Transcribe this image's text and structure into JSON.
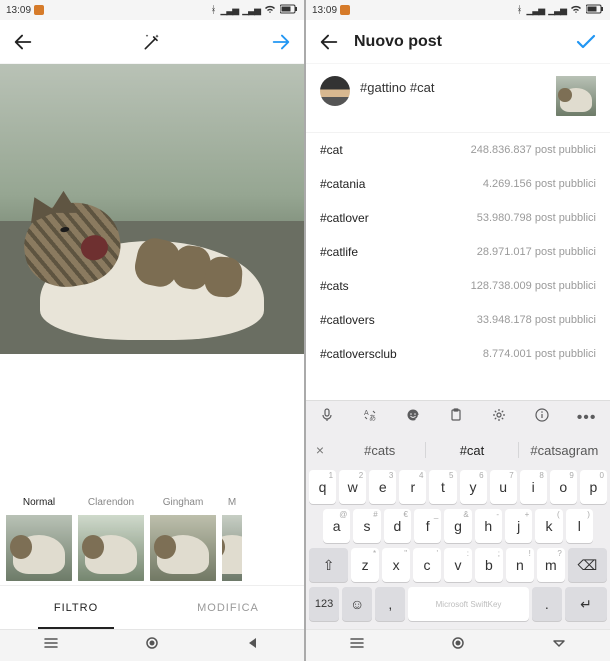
{
  "statusbar": {
    "time": "13:09"
  },
  "left": {
    "filters": [
      {
        "label": "Normal"
      },
      {
        "label": "Clarendon"
      },
      {
        "label": "Gingham"
      },
      {
        "label": "M"
      }
    ],
    "tabs": {
      "filter": "FILTRO",
      "edit": "MODIFICA"
    }
  },
  "right": {
    "title": "Nuovo post",
    "caption": "#gattino #cat",
    "suggestions": [
      {
        "tag": "#cat",
        "count": "248.836.837 post pubblici"
      },
      {
        "tag": "#catania",
        "count": "4.269.156 post pubblici"
      },
      {
        "tag": "#catlover",
        "count": "53.980.798 post pubblici"
      },
      {
        "tag": "#catlife",
        "count": "28.971.017 post pubblici"
      },
      {
        "tag": "#cats",
        "count": "128.738.009 post pubblici"
      },
      {
        "tag": "#catlovers",
        "count": "33.948.178 post pubblici"
      },
      {
        "tag": "#catloversclub",
        "count": "8.774.001 post pubblici"
      }
    ]
  },
  "keyboard": {
    "predictions": [
      "#cats",
      "#cat",
      "#catsagram"
    ],
    "row1": [
      {
        "k": "q",
        "a": "1"
      },
      {
        "k": "w",
        "a": "2"
      },
      {
        "k": "e",
        "a": "3"
      },
      {
        "k": "r",
        "a": "4"
      },
      {
        "k": "t",
        "a": "5"
      },
      {
        "k": "y",
        "a": "6"
      },
      {
        "k": "u",
        "a": "7"
      },
      {
        "k": "i",
        "a": "8"
      },
      {
        "k": "o",
        "a": "9"
      },
      {
        "k": "p",
        "a": "0"
      }
    ],
    "row2": [
      {
        "k": "a",
        "a": "@"
      },
      {
        "k": "s",
        "a": "#"
      },
      {
        "k": "d",
        "a": "€"
      },
      {
        "k": "f",
        "a": "_"
      },
      {
        "k": "g",
        "a": "&"
      },
      {
        "k": "h",
        "a": "-"
      },
      {
        "k": "j",
        "a": "+"
      },
      {
        "k": "k",
        "a": "("
      },
      {
        "k": "l",
        "a": ")"
      }
    ],
    "row3": [
      {
        "k": "z",
        "a": "*"
      },
      {
        "k": "x",
        "a": "\""
      },
      {
        "k": "c",
        "a": "'"
      },
      {
        "k": "v",
        "a": ":"
      },
      {
        "k": "b",
        "a": ";"
      },
      {
        "k": "n",
        "a": "!"
      },
      {
        "k": "m",
        "a": "?"
      }
    ],
    "fn": {
      "shift": "⇧",
      "back": "⌫",
      "sym": "123",
      "emoji": "☺",
      "space": "Microsoft SwiftKey",
      "comma": ",",
      "dot": ".",
      "enter": "↵"
    }
  }
}
